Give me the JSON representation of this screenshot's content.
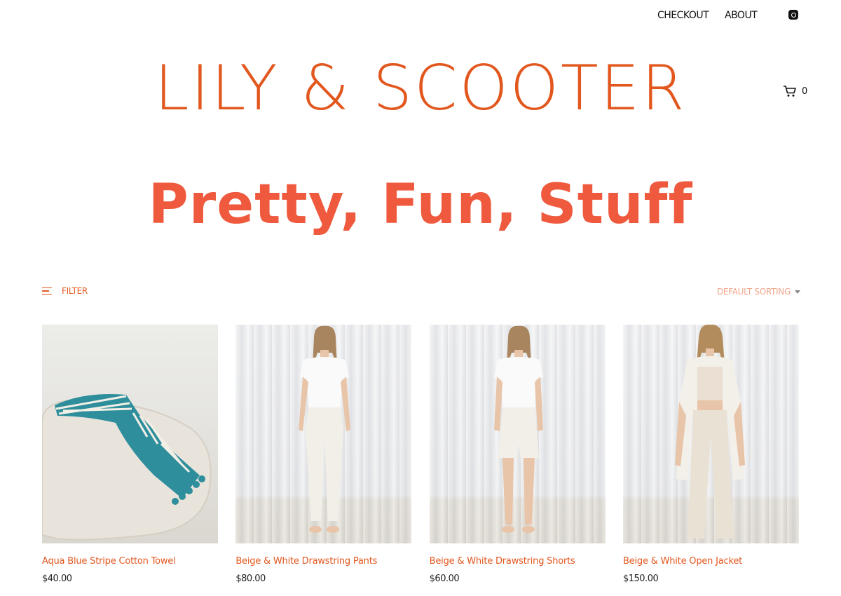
{
  "nav": {
    "checkout_label": "CHECKOUT",
    "about_label": "ABOUT",
    "instagram_icon": "instagram-icon"
  },
  "brand": {
    "logo_text": "LILY & SCOOTER",
    "accent_color": "#e2571e"
  },
  "cart": {
    "icon": "shopping-cart-icon",
    "count": "0"
  },
  "hero": {
    "headline": "Pretty, Fun, Stuff",
    "color": "#ef5a3f"
  },
  "toolbar": {
    "filter_label": "FILTER",
    "filter_icon": "hamburger-icon",
    "sorting_label": "DEFAULT SORTING",
    "sorting_icon": "caret-down-icon"
  },
  "products": [
    {
      "name": "Aqua Blue Stripe Cotton Towel",
      "price": "$40.00",
      "image": "towel-on-pouf-photo"
    },
    {
      "name": "Beige & White Drawstring Pants",
      "price": "$80.00",
      "image": "model-white-top-pants-photo"
    },
    {
      "name": "Beige & White Drawstring Shorts",
      "price": "$60.00",
      "image": "model-white-top-shorts-photo"
    },
    {
      "name": "Beige & White Open Jacket",
      "price": "$150.00",
      "image": "model-open-jacket-photo"
    }
  ]
}
